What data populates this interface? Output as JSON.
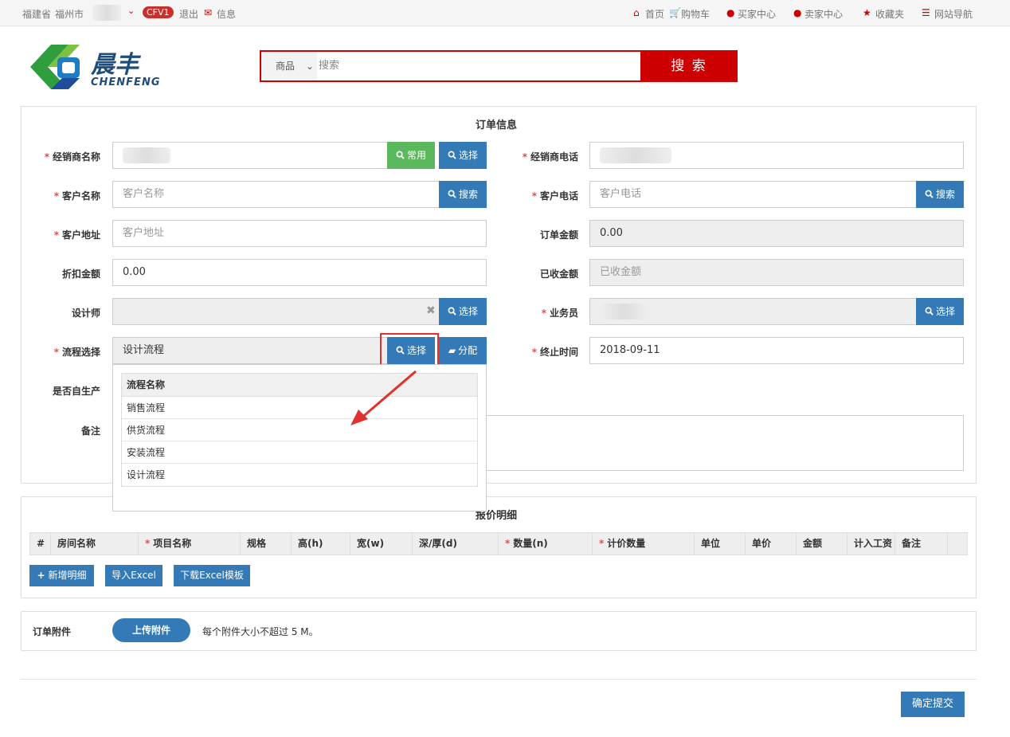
{
  "topbar": {
    "province": "福建省",
    "city": "福州市",
    "badge": "CFV1",
    "logout": "退出",
    "messages": "信息",
    "home": "首页",
    "cart": "购物车",
    "buyer_center": "买家中心",
    "seller_center": "卖家中心",
    "favorites": "收藏夹",
    "site_nav": "网站导航"
  },
  "logo": {
    "title": "晨丰",
    "subtitle": "CHENFENG"
  },
  "search": {
    "category": "商品",
    "placeholder": "搜索",
    "button": "搜 索"
  },
  "order_info": {
    "title": "订单信息",
    "dealer_name": {
      "label": "经销商名称",
      "value": "",
      "btn_common": "常用",
      "btn_select": "选择"
    },
    "dealer_phone": {
      "label": "经销商电话",
      "value": ""
    },
    "customer_name": {
      "label": "客户名称",
      "placeholder": "客户名称",
      "btn": "搜索"
    },
    "customer_phone": {
      "label": "客户电话",
      "placeholder": "客户电话",
      "btn": "搜索"
    },
    "customer_address": {
      "label": "客户地址",
      "placeholder": "客户地址"
    },
    "order_amount": {
      "label": "订单金额",
      "value": "0.00"
    },
    "discount_amount": {
      "label": "折扣金额",
      "value": "0.00"
    },
    "received_amount": {
      "label": "已收金额",
      "placeholder": "已收金额"
    },
    "designer": {
      "label": "设计师",
      "value": "",
      "btn": "选择"
    },
    "salesman": {
      "label": "业务员",
      "value": "",
      "btn": "选择"
    },
    "flow": {
      "label": "流程选择",
      "value": "设计流程",
      "btn_select": "选择",
      "btn_assign": "分配"
    },
    "end_time": {
      "label": "终止时间",
      "value": "2018-09-11"
    },
    "self_produce": {
      "label": "是否自生产"
    },
    "remark": {
      "label": "备注"
    }
  },
  "flow_dropdown": {
    "header": "流程名称",
    "rows": [
      "销售流程",
      "供货流程",
      "安装流程",
      "设计流程"
    ]
  },
  "quote_detail": {
    "title": "报价明细",
    "columns": [
      "#",
      "房间名称",
      "项目名称",
      "规格",
      "高(h)",
      "宽(w)",
      "深/厚(d)",
      "数量(n)",
      "计价数量",
      "单位",
      "单价",
      "金额",
      "计入工资",
      "备注"
    ],
    "required_columns": [
      "项目名称",
      "数量(n)",
      "计价数量"
    ],
    "add_btn": "新增明细",
    "import_btn": "导入Excel",
    "download_btn": "下载Excel模板"
  },
  "attachment": {
    "label": "订单附件",
    "upload_btn": "上传附件",
    "note": "每个附件大小不超过 5 M。"
  },
  "submit_btn": "确定提交",
  "colors": {
    "accent_red": "#cc0000",
    "primary_blue": "#337ab7",
    "success_green": "#5cb85c",
    "required": "#d9534f"
  }
}
